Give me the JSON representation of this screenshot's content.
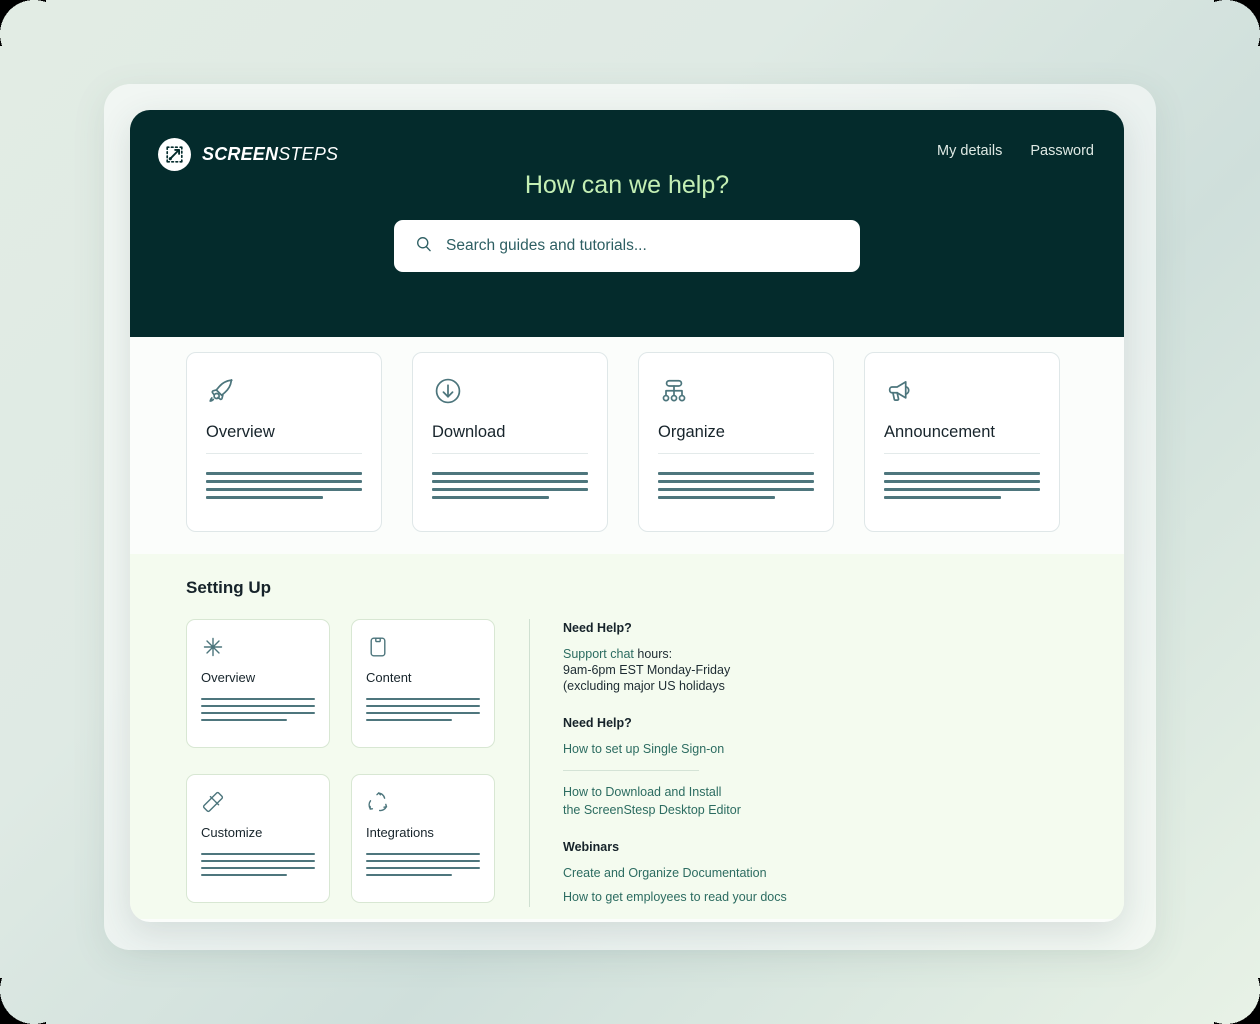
{
  "brand": {
    "name_bold": "SCREEN",
    "name_light": "STEPS",
    "logo_icon": "screensteps-logo-icon"
  },
  "header": {
    "nav": [
      {
        "label": "My details"
      },
      {
        "label": "Password"
      }
    ],
    "title": "How can we help?",
    "search": {
      "placeholder": "Search guides and tutorials...",
      "value": "",
      "icon": "search-icon"
    },
    "background_color": "#042b2c",
    "title_color": "#c4efb4"
  },
  "categories": [
    {
      "title": "Overview",
      "icon": "rocket-icon"
    },
    {
      "title": "Download",
      "icon": "download-circle-icon"
    },
    {
      "title": "Organize",
      "icon": "hierarchy-icon"
    },
    {
      "title": "Announcement",
      "icon": "megaphone-icon"
    }
  ],
  "setting_up": {
    "title": "Setting Up",
    "cards": [
      {
        "title": "Overview",
        "icon": "sparkle-icon"
      },
      {
        "title": "Content",
        "icon": "clipboard-icon"
      },
      {
        "title": "Customize",
        "icon": "ruler-icon"
      },
      {
        "title": "Integrations",
        "icon": "recycle-arrows-icon"
      }
    ],
    "help": {
      "need_help_1": "Need Help?",
      "support_link": "Support chat",
      "support_suffix": " hours:",
      "hours_line_1": "9am-6pm EST Monday-Friday",
      "hours_line_2": "(excluding major US holidays",
      "need_help_2": "Need Help?",
      "link_sso": "How to set up Single Sign-on",
      "link_download_line_1": "How to Download and Install",
      "link_download_line_2": "the ScreenStesp Desktop Editor",
      "webinars_title": "Webinars",
      "webinar_1": "Create and Organize Documentation",
      "webinar_2": "How to get employees to read your docs"
    }
  },
  "colors": {
    "accent_green": "#c4efb4",
    "dark_teal": "#042b2c",
    "link_teal": "#2c6c61",
    "bar_teal": "#4e767d"
  }
}
